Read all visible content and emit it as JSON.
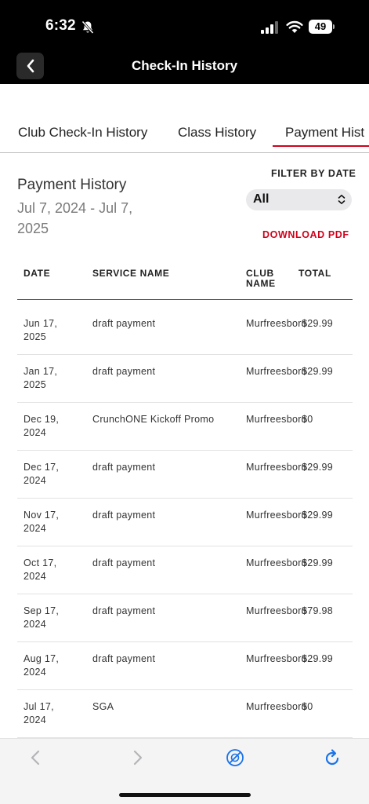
{
  "status_bar": {
    "time": "6:32",
    "battery": "49"
  },
  "header": {
    "title": "Check-In History"
  },
  "tabs": [
    {
      "label": "Club Check-In History"
    },
    {
      "label": "Class History"
    },
    {
      "label": "Payment Hist"
    }
  ],
  "payment": {
    "title": "Payment History",
    "date_range": "Jul 7, 2024 - Jul 7, 2025",
    "filter_label": "FILTER BY DATE",
    "filter_value": "All",
    "download_label": "DOWNLOAD PDF"
  },
  "table": {
    "headers": {
      "date": "DATE",
      "service": "SERVICE NAME",
      "club": "CLUB NAME",
      "total": "TOTAL"
    },
    "rows": [
      {
        "date": "Jun 17, 2025",
        "service": "draft payment",
        "club": "Murfreesboro",
        "total": "$29.99"
      },
      {
        "date": "Jan 17, 2025",
        "service": "draft payment",
        "club": "Murfreesboro",
        "total": "$29.99"
      },
      {
        "date": "Dec 19, 2024",
        "service": "CrunchONE Kickoff Promo",
        "club": "Murfreesboro",
        "total": "$0"
      },
      {
        "date": "Dec 17, 2024",
        "service": "draft payment",
        "club": "Murfreesboro",
        "total": "$29.99"
      },
      {
        "date": "Nov 17, 2024",
        "service": "draft payment",
        "club": "Murfreesboro",
        "total": "$29.99"
      },
      {
        "date": "Oct 17, 2024",
        "service": "draft payment",
        "club": "Murfreesboro",
        "total": "$29.99"
      },
      {
        "date": "Sep 17, 2024",
        "service": "draft payment",
        "club": "Murfreesboro",
        "total": "$79.98"
      },
      {
        "date": "Aug 17, 2024",
        "service": "draft payment",
        "club": "Murfreesboro",
        "total": "$29.99"
      },
      {
        "date": "Jul 17, 2024",
        "service": "SGA",
        "club": "Murfreesboro",
        "total": "$0"
      }
    ]
  },
  "toolbar": {
    "icons": [
      "back-arrow-icon",
      "forward-arrow-icon",
      "tracking-blocked-icon",
      "reload-icon"
    ],
    "accent": "#1a73e8"
  },
  "colors": {
    "brand_red": "#d0021b",
    "header_bg": "#000000"
  }
}
